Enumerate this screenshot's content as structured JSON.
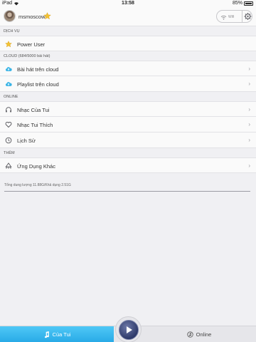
{
  "status_bar": {
    "device": "iPad",
    "time": "13:58",
    "battery": "85%",
    "battery_level": 0.85
  },
  "header": {
    "username": "msmoscow",
    "network_label": "Wifi"
  },
  "sections": [
    {
      "title": "DỊCH VỤ",
      "items": [
        {
          "label": "Power User",
          "icon": "vip-star-icon"
        }
      ]
    },
    {
      "title": "CLOUD (684/5000 bài hát)",
      "items": [
        {
          "label": "Bài hát trên cloud",
          "icon": "cloud-icon"
        },
        {
          "label": "Playlist trên cloud",
          "icon": "cloud-icon"
        }
      ]
    },
    {
      "title": "ONLINE",
      "items": [
        {
          "label": "Nhạc Của Tui",
          "icon": "headphones-icon"
        },
        {
          "label": "Nhạc Tui Thích",
          "icon": "heart-icon"
        },
        {
          "label": "Lịch Sử",
          "icon": "clock-icon"
        }
      ]
    },
    {
      "title": "THÊM",
      "items": [
        {
          "label": "Ứng Dụng Khác",
          "icon": "apps-icon"
        }
      ]
    }
  ],
  "storage": {
    "text": "Tổng dung lượng 11.88G/Khả dụng 2.51G"
  },
  "bottom_bar": {
    "tab_left": "Của Tui",
    "tab_right": "Online"
  },
  "colors": {
    "accent": "#27a9e6",
    "cloud": "#3ab4e6",
    "star": "#f2c233"
  }
}
